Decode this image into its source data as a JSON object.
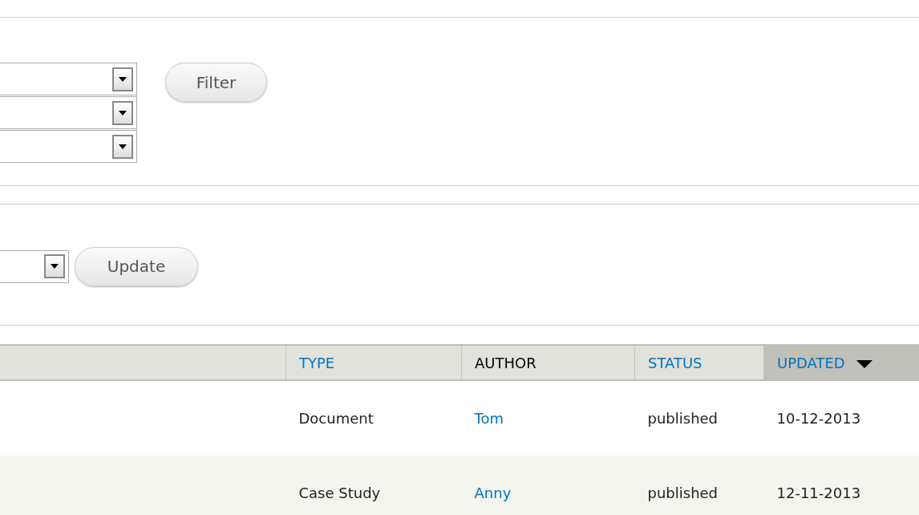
{
  "filter_form": {
    "selects": [
      {
        "kind": "dropdown"
      },
      {
        "kind": "dropdown"
      },
      {
        "kind": "dropdown"
      }
    ],
    "button": "Filter"
  },
  "update_form": {
    "selects": [
      {
        "kind": "dropdown"
      }
    ],
    "button": "Update"
  },
  "table": {
    "columns": [
      {
        "label": "TYPE",
        "kind": "link",
        "selected": false
      },
      {
        "label": "AUTHOR",
        "kind": "plain",
        "selected": false
      },
      {
        "label": "STATUS",
        "kind": "link",
        "selected": false
      },
      {
        "label": "UPDATED",
        "kind": "link",
        "selected": true
      }
    ],
    "rows": [
      {
        "cells": [
          {
            "text": "Document",
            "kind": "plain"
          },
          {
            "text": "Tom",
            "kind": "link"
          },
          {
            "text": "published",
            "kind": "plain"
          },
          {
            "text": "10-12-2013",
            "kind": "plain"
          }
        ]
      },
      {
        "cells": [
          {
            "text": "Case Study",
            "kind": "plain"
          },
          {
            "text": "Anny",
            "kind": "link"
          },
          {
            "text": "published",
            "kind": "plain"
          },
          {
            "text": "12-11-2013",
            "kind": "plain"
          }
        ]
      }
    ]
  }
}
